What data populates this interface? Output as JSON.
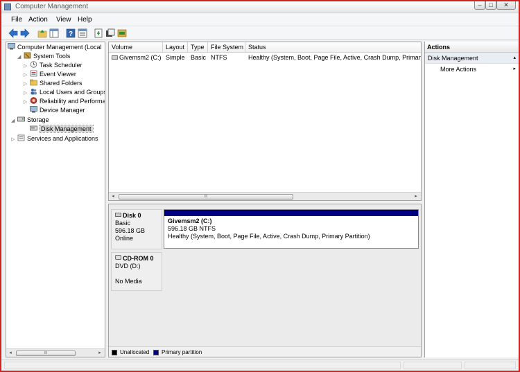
{
  "window": {
    "title": "Computer Management",
    "minimize": "–",
    "maximize": "□",
    "close": "✕"
  },
  "menu": [
    "File",
    "Action",
    "View",
    "Help"
  ],
  "toolbar": {
    "icons": [
      "back-arrow-icon",
      "forward-arrow-icon",
      "up-folder-icon",
      "show-hide-tree-icon",
      "help-icon",
      "properties-icon",
      "export-icon",
      "settings-icon",
      "refresh-icon"
    ]
  },
  "tree": {
    "root": "Computer Management (Local",
    "system_tools": "System Tools",
    "task_scheduler": "Task Scheduler",
    "event_viewer": "Event Viewer",
    "shared_folders": "Shared Folders",
    "local_users": "Local Users and Groups",
    "reliability": "Reliability and Performa",
    "device_manager": "Device Manager",
    "storage": "Storage",
    "disk_management": "Disk Management",
    "services": "Services and Applications"
  },
  "volume_list": {
    "headers": [
      "Volume",
      "Layout",
      "Type",
      "File System",
      "Status"
    ],
    "rows": [
      {
        "volume": "Givemsm2 (C:)",
        "layout": "Simple",
        "type": "Basic",
        "fs": "NTFS",
        "status": "Healthy (System, Boot, Page File, Active, Crash Dump, Primary"
      }
    ],
    "scroll_grip": "III"
  },
  "disks": {
    "disk0": {
      "name": "Disk 0",
      "type": "Basic",
      "size": "596.18 GB",
      "state": "Online"
    },
    "partition": {
      "name": "Givemsm2  (C:)",
      "size": "596.18 GB NTFS",
      "status": "Healthy (System, Boot, Page File, Active, Crash Dump, Primary Partition)"
    },
    "cdrom": {
      "name": "CD-ROM 0",
      "type": "DVD (D:)",
      "media": "No Media"
    }
  },
  "legend": [
    {
      "label": "Unallocated",
      "color": "#000000"
    },
    {
      "label": "Primary partition",
      "color": "#000080"
    }
  ],
  "actions": {
    "header": "Actions",
    "section": "Disk Management",
    "more": "More Actions"
  },
  "glyphs": {
    "expanded": "◢",
    "collapsed": "▷",
    "left": "◂",
    "right": "▸",
    "up": "▴"
  }
}
